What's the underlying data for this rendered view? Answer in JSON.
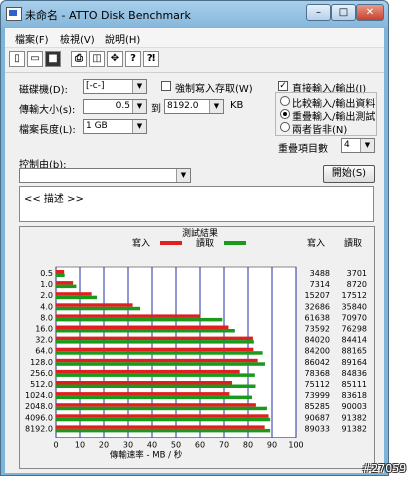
{
  "window": {
    "title": "未命名 - ATTO Disk Benchmark",
    "min": "–",
    "max": "□",
    "close": "✕"
  },
  "menu": [
    "檔案(F)",
    "檢視(V)",
    "說明(H)"
  ],
  "toolbar_icons": [
    "new-file-icon",
    "open-folder-icon",
    "save-icon",
    "print-icon",
    "print-preview-icon",
    "move-icon",
    "help-icon",
    "context-help-icon"
  ],
  "settings": {
    "drive_label": "磁碟機(D):",
    "drive_value": "[-c-]",
    "transfer_label": "傳輸大小(s):",
    "transfer_from": "0.5",
    "transfer_to_label": "到",
    "transfer_to": "8192.0",
    "transfer_unit": "KB",
    "length_label": "檔案長度(L):",
    "length_value": "1 GB",
    "force_write_label": "強制寫入存取(W)",
    "direct_io_label": "直接輸入/輸出(I)",
    "radio_compare": "比較輸入/輸出資料",
    "radio_overlap": "重疊輸入/輸出測試",
    "radio_neither": "兩者皆非(N)",
    "queue_label": "重疊項目數",
    "queue_value": "4",
    "control_label": "控制由(b):",
    "start_button": "開始(S)",
    "description": "<<     描述     >>"
  },
  "legend": {
    "title": "測試結果",
    "write": "寫入",
    "read": "讀取",
    "col_write": "寫入",
    "col_read": "讀取"
  },
  "colors": {
    "write": "#e02020",
    "read": "#1a9a1a",
    "grid": "#1f2fa8"
  },
  "chart_data": {
    "type": "bar",
    "title": "測試結果",
    "xlabel": "傳輸速率 - MB / 秒",
    "xlim": [
      0,
      100
    ],
    "xticks": [
      0,
      10,
      20,
      30,
      40,
      50,
      60,
      70,
      80,
      90,
      100
    ],
    "categories": [
      "0.5",
      "1.0",
      "2.0",
      "4.0",
      "8.0",
      "16.0",
      "32.0",
      "64.0",
      "128.0",
      "256.0",
      "512.0",
      "1024.0",
      "2048.0",
      "4096.0",
      "8192.0"
    ],
    "series": [
      {
        "name": "寫入",
        "color": "#e02020",
        "values": [
          3488,
          7314,
          15207,
          32686,
          61638,
          73592,
          84020,
          84200,
          86042,
          78368,
          75112,
          73999,
          85285,
          90687,
          89033
        ]
      },
      {
        "name": "讀取",
        "color": "#1a9a1a",
        "values": [
          3701,
          8720,
          17512,
          35840,
          70970,
          76298,
          84414,
          88165,
          89164,
          84836,
          85111,
          83618,
          90003,
          91382,
          91382
        ]
      }
    ],
    "value_unit": "KB/s"
  },
  "watermark": "#27059"
}
